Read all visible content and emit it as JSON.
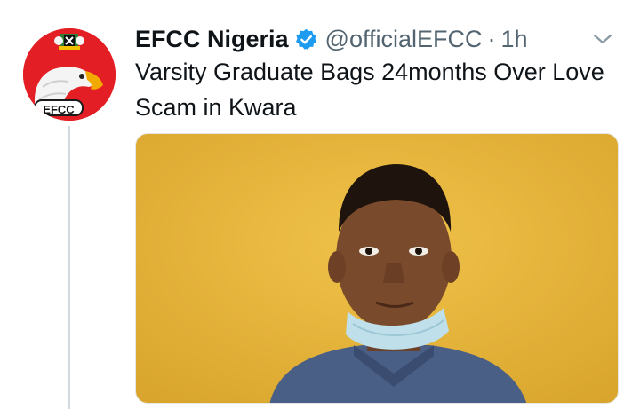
{
  "tweet": {
    "display_name": "EFCC Nigeria",
    "handle": "@officialEFCC",
    "separator": "·",
    "time": "1h",
    "text": "Varsity Graduate Bags 24months Over Love Scam in Kwara",
    "verified": true
  },
  "avatar": {
    "logo_text": "EFCC",
    "background_color": "#e31e24"
  },
  "icons": {
    "verified": "verified-badge-icon",
    "more": "chevron-down-icon"
  },
  "colors": {
    "verified_blue": "#1d9bf0",
    "secondary_text": "#536471",
    "thread_line": "#cfd9de",
    "photo_wall": "#e8b73c"
  }
}
